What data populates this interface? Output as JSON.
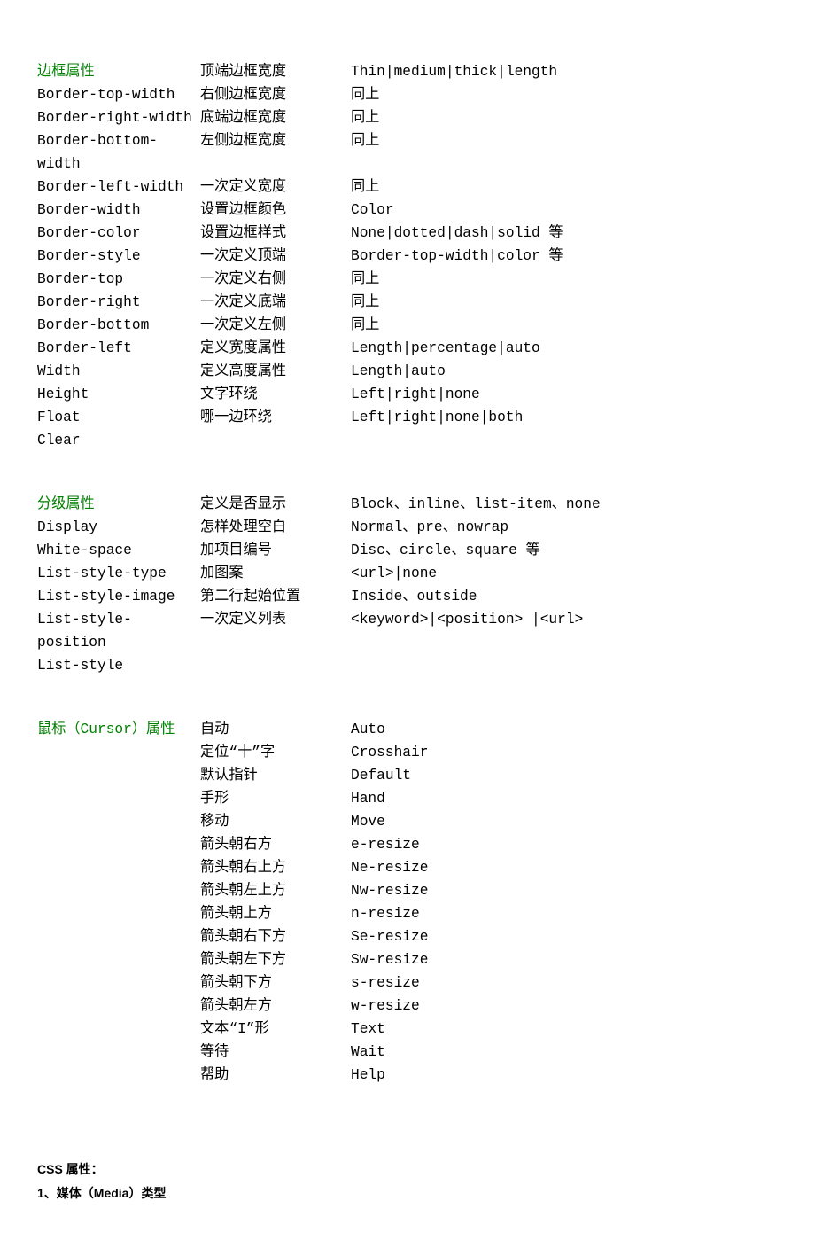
{
  "sections": [
    {
      "heading": "边框属性",
      "rows": [
        {
          "c1": "",
          "c2": "顶端边框宽度",
          "c3": "Thin|medium|thick|length"
        },
        {
          "c1": "Border-top-width",
          "c2": "右侧边框宽度",
          "c3": "同上"
        },
        {
          "c1": "Border-right-width",
          "c2": "底端边框宽度",
          "c3": "同上"
        },
        {
          "c1": "Border-bottom-width",
          "c2": "左侧边框宽度",
          "c3": "同上"
        },
        {
          "c1": "Border-left-width",
          "c2": "一次定义宽度",
          "c3": "同上"
        },
        {
          "c1": "Border-width",
          "c2": "设置边框颜色",
          "c3": "Color"
        },
        {
          "c1": "Border-color",
          "c2": "设置边框样式",
          "c3": "None|dotted|dash|solid 等"
        },
        {
          "c1": "Border-style",
          "c2": "一次定义顶端",
          "c3": "Border-top-width|color 等"
        },
        {
          "c1": "Border-top",
          "c2": "一次定义右侧",
          "c3": "同上"
        },
        {
          "c1": "Border-right",
          "c2": "一次定义底端",
          "c3": "同上"
        },
        {
          "c1": "Border-bottom",
          "c2": "一次定义左侧",
          "c3": "同上"
        },
        {
          "c1": "Border-left",
          "c2": "定义宽度属性",
          "c3": "Length|percentage|auto"
        },
        {
          "c1": "Width",
          "c2": "定义高度属性",
          "c3": "Length|auto"
        },
        {
          "c1": "Height",
          "c2": "文字环绕",
          "c3": "Left|right|none"
        },
        {
          "c1": "Float",
          "c2": "哪一边环绕",
          "c3": "Left|right|none|both"
        },
        {
          "c1": "Clear",
          "c2": "",
          "c3": ""
        }
      ]
    },
    {
      "heading": "分级属性",
      "rows": [
        {
          "c1": "",
          "c2": "定义是否显示",
          "c3": "Block、inline、list-item、none"
        },
        {
          "c1": "Display",
          "c2": "怎样处理空白",
          "c3": "Normal、pre、nowrap"
        },
        {
          "c1": "White-space",
          "c2": "加项目编号",
          "c3": "Disc、circle、square 等"
        },
        {
          "c1": "List-style-type",
          "c2": "加图案",
          "c3": "<url>|none"
        },
        {
          "c1": "List-style-image",
          "c2": "第二行起始位置",
          "c3": "Inside、outside"
        },
        {
          "c1": "List-style-position",
          "c2": "一次定义列表",
          "c3": "<keyword>|<position>  |<url>"
        },
        {
          "c1": "List-style",
          "c2": "",
          "c3": ""
        }
      ]
    },
    {
      "heading": "鼠标（Cursor）属性",
      "rows": [
        {
          "c1": "",
          "c2": "自动",
          "c3": "Auto"
        },
        {
          "c1": "",
          "c2": "定位“十”字",
          "c3": "Crosshair"
        },
        {
          "c1": "",
          "c2": "默认指针",
          "c3": "Default"
        },
        {
          "c1": "",
          "c2": "手形",
          "c3": "Hand"
        },
        {
          "c1": "",
          "c2": "移动",
          "c3": "Move"
        },
        {
          "c1": "",
          "c2": "箭头朝右方",
          "c3": "e-resize"
        },
        {
          "c1": "",
          "c2": "箭头朝右上方",
          "c3": "Ne-resize"
        },
        {
          "c1": "",
          "c2": "箭头朝左上方",
          "c3": "Nw-resize"
        },
        {
          "c1": "",
          "c2": "箭头朝上方",
          "c3": "n-resize"
        },
        {
          "c1": "",
          "c2": "箭头朝右下方",
          "c3": "Se-resize"
        },
        {
          "c1": "",
          "c2": "箭头朝左下方",
          "c3": "Sw-resize"
        },
        {
          "c1": "",
          "c2": "箭头朝下方",
          "c3": "s-resize"
        },
        {
          "c1": "",
          "c2": "箭头朝左方",
          "c3": "w-resize"
        },
        {
          "c1": "",
          "c2": "文本“I”形",
          "c3": "Text"
        },
        {
          "c1": "",
          "c2": "等待",
          "c3": "Wait"
        },
        {
          "c1": "",
          "c2": "帮助",
          "c3": "Help"
        }
      ]
    }
  ],
  "footer": {
    "line1": "CSS 属性：",
    "line2": "1、媒体（Media）类型"
  }
}
